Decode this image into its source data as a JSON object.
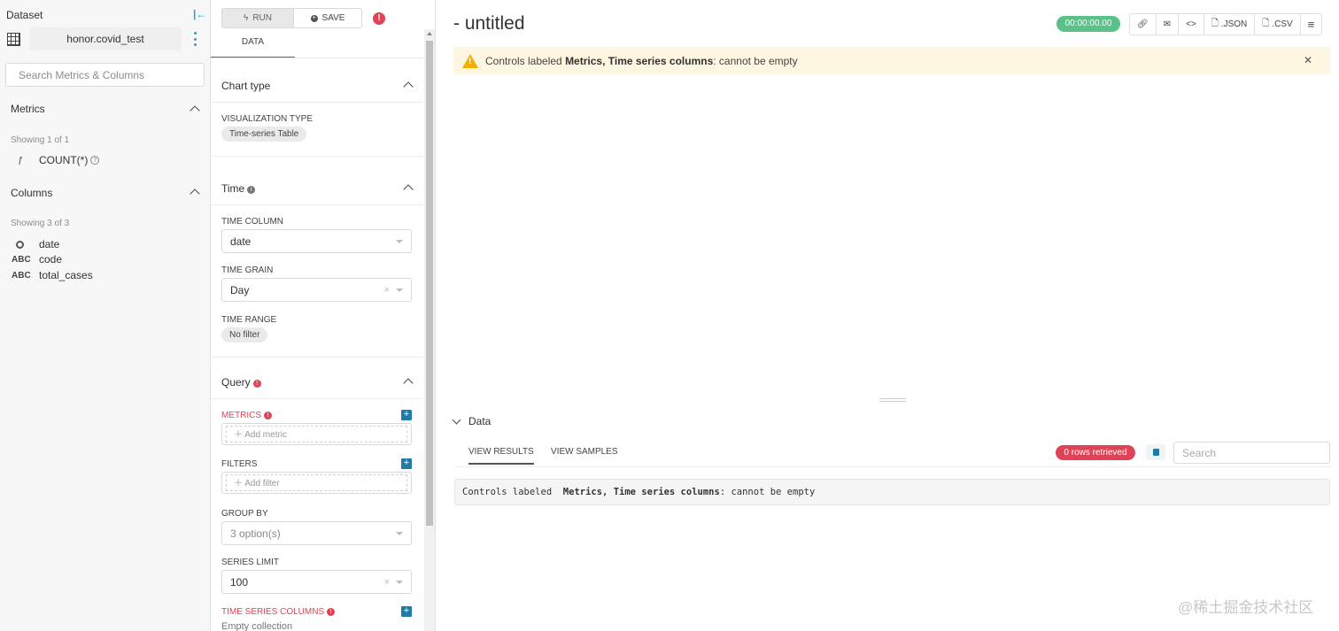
{
  "dataset": {
    "title": "Dataset",
    "name": "honor.covid_test",
    "search_placeholder": "Search Metrics & Columns",
    "metrics_title": "Metrics",
    "metrics_showing": "Showing 1 of 1",
    "metrics": [
      {
        "icon": "ƒ",
        "name": "COUNT(*)"
      }
    ],
    "columns_title": "Columns",
    "columns_showing": "Showing 3 of 3",
    "columns": [
      {
        "type": "clock",
        "name": "date"
      },
      {
        "type": "ABC",
        "name": "code"
      },
      {
        "type": "ABC",
        "name": "total_cases"
      }
    ]
  },
  "controls": {
    "run_label": "RUN",
    "save_label": "SAVE",
    "tab_data": "DATA",
    "chart_type": {
      "title": "Chart type",
      "viz_label": "VISUALIZATION TYPE",
      "viz_value": "Time-series Table"
    },
    "time": {
      "title": "Time",
      "time_column_label": "TIME COLUMN",
      "time_column_value": "date",
      "time_grain_label": "TIME GRAIN",
      "time_grain_value": "Day",
      "time_range_label": "TIME RANGE",
      "time_range_value": "No filter"
    },
    "query": {
      "title": "Query",
      "metrics_label": "METRICS",
      "metrics_placeholder": "Add metric",
      "filters_label": "FILTERS",
      "filters_placeholder": "Add filter",
      "groupby_label": "GROUP BY",
      "groupby_value": "3 option(s)",
      "series_limit_label": "SERIES LIMIT",
      "series_limit_value": "100",
      "ts_columns_label": "TIME SERIES COLUMNS",
      "ts_columns_value": "Empty collection"
    }
  },
  "main": {
    "title": "- untitled",
    "timer": "00:00:00.00",
    "json_label": ".JSON",
    "csv_label": ".CSV",
    "alert": {
      "prefix": "Controls labeled ",
      "bold": "Metrics, Time series columns",
      "suffix": ": cannot be empty"
    },
    "data_section": {
      "title": "Data",
      "tab_results": "VIEW RESULTS",
      "tab_samples": "VIEW SAMPLES",
      "rows_badge": "0 rows retrieved",
      "search_placeholder": "Search",
      "error_prefix": "Controls labeled  ",
      "error_bold": "Metrics, Time series columns",
      "error_suffix": ": cannot be empty"
    },
    "watermark": "@稀土掘金技术社区"
  },
  "colors": {
    "accent": "#1fa8c9",
    "error": "#e04355",
    "success": "#5ac189",
    "warning_bg": "#fdf6e0",
    "warning_icon": "#f0b000"
  }
}
